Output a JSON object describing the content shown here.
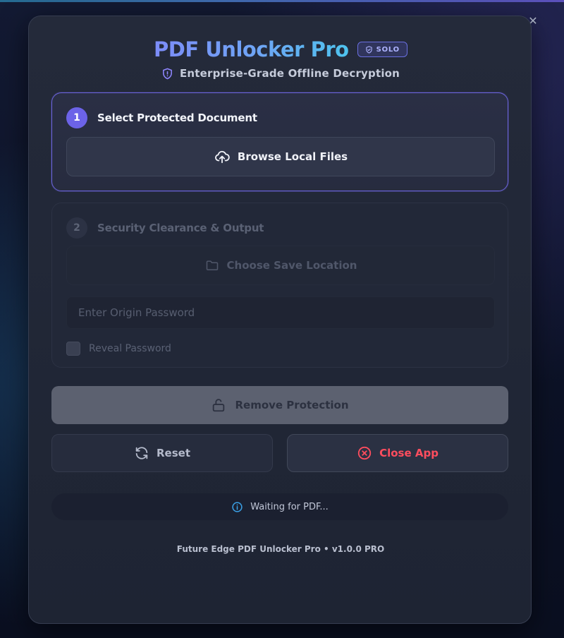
{
  "window": {
    "minimize_icon": "minimize-icon",
    "close_glyph": "✕"
  },
  "header": {
    "title": "PDF Unlocker Pro",
    "badge": "SOLO",
    "subtitle": "Enterprise-Grade Offline Decryption"
  },
  "step1": {
    "number": "1",
    "title": "Select Protected Document",
    "browse_label": "Browse Local Files"
  },
  "step2": {
    "number": "2",
    "title": "Security Clearance & Output",
    "save_label": "Choose Save Location",
    "password_placeholder": "Enter Origin Password",
    "reveal_label": "Reveal Password"
  },
  "actions": {
    "remove_label": "Remove Protection",
    "reset_label": "Reset",
    "close_label": "Close App"
  },
  "status": {
    "text": "Waiting for PDF..."
  },
  "footer": {
    "text": "Future Edge PDF Unlocker Pro • v1.0.0 PRO"
  },
  "colors": {
    "accent": "#6c63e8",
    "danger": "#ff4d5e",
    "info": "#3aa0e6"
  }
}
